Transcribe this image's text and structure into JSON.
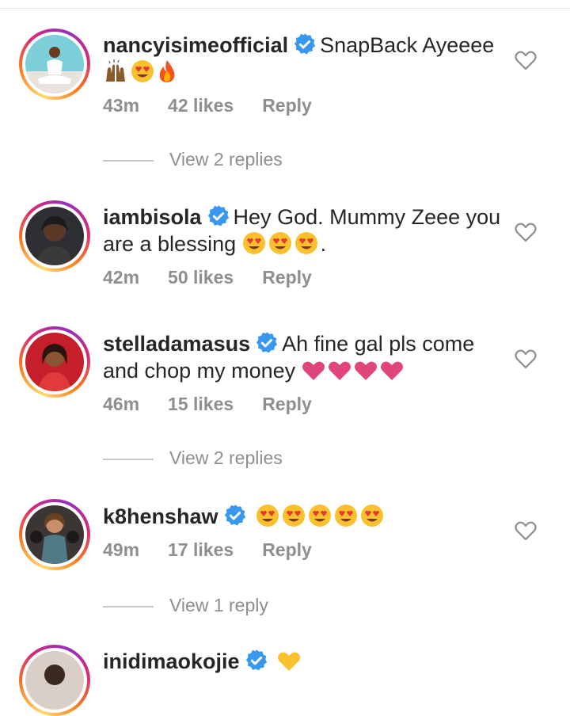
{
  "comments": [
    {
      "username": "nancyisimeofficial",
      "text": "SnapBack Ayeeee",
      "time": "43m",
      "likes": "42 likes",
      "reply": "Reply",
      "view_replies": "View 2 replies"
    },
    {
      "username": "iambisola",
      "text": "Hey God. Mummy Zeee you are a blessing",
      "text_suffix": ".",
      "time": "42m",
      "likes": "50 likes",
      "reply": "Reply"
    },
    {
      "username": "stelladamasus",
      "text": "Ah fine gal pls come and chop my money",
      "time": "46m",
      "likes": "15 likes",
      "reply": "Reply",
      "view_replies": "View 2 replies"
    },
    {
      "username": "k8henshaw",
      "text": "",
      "time": "49m",
      "likes": "17 likes",
      "reply": "Reply",
      "view_replies": "View 1 reply"
    },
    {
      "username": "inidimaokojie",
      "text": ""
    }
  ],
  "colors": {
    "verified": "#3897f0",
    "secondary_text": "#8e8e8e",
    "heart_emoji": "#e0457b"
  },
  "icons": [
    "verified-badge-icon",
    "heart-outline-icon",
    "heart-eyes-emoji",
    "raised-hands-emoji",
    "fire-emoji",
    "pink-heart-emoji",
    "yellow-heart-emoji"
  ]
}
